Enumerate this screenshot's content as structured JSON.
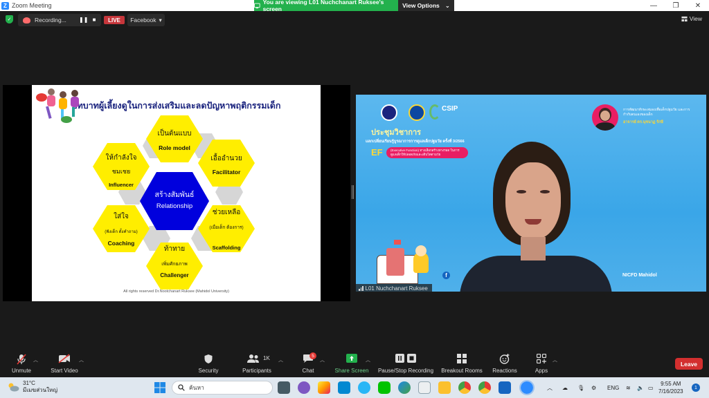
{
  "titlebar": {
    "app_title": "Zoom Meeting",
    "logo": "zoom-logo",
    "minimize": "—",
    "restore": "❐",
    "close": "✕"
  },
  "viewing_banner": {
    "text": "You are viewing L01 Nuchchanart Ruksee's screen",
    "options_label": "View Options"
  },
  "top_toolbar": {
    "recording_label": "Recording...",
    "live_label": "LIVE",
    "stream_target": "Facebook",
    "view_label": "View"
  },
  "slide": {
    "title": "บทบาทผู้เลี้ยงดูในการส่งเสริมและลดปัญหาพฤติกรรมเด็ก",
    "center_thai": "สร้างสัมพันธ์",
    "center_en": "Relationship",
    "hexes": [
      {
        "thai": "เป็นต้นแบบ",
        "en": "Role model",
        "sub": ""
      },
      {
        "thai": "เอื้ออำนวย",
        "en": "Facilitator",
        "sub": ""
      },
      {
        "thai": "ช่วยเหลือ",
        "en": "Scaffolding",
        "sub": "(เมื่อเด็ก ต้องการ)"
      },
      {
        "thai": "ท้าทาย",
        "en": "Challenger",
        "sub": "เพิ่มศักยภาพ"
      },
      {
        "thai": "ใส่ใจ",
        "en": "Coaching",
        "sub": "(ฟังเด็ก ตั้งคำถาม)"
      },
      {
        "thai": "ให้กำลังใจ",
        "en": "Influencer",
        "sub": "ชมเชย"
      }
    ],
    "copyright": "All rights reserved Dr.Nootchanart Ruksee (Mahidol University)",
    "colors": {
      "hex_yellow": "#ffee00",
      "center_blue": "#0000dd",
      "title_navy": "#1a237e",
      "hex_gray": "#d6d6d6"
    }
  },
  "video": {
    "participant": "L01 Nuchchanart Ruksee",
    "banner_title": "ประชุมวิชาการ",
    "banner_sub": "แลกเปลี่ยนเรียนรู้บูรณาการการดูแลเด็กปฐมวัย ครั้งที่ 3/2566",
    "banner_ef": "EF",
    "banner_pill": "(Executive Function) ทางเลือกสร้างทางรอด ในการดูแลเด็กให้ปลอดภัยและเติบโตตามวัย",
    "csip": "CSIP",
    "speaker_caption": "การพัฒนาทักษะสมองเพื่อเด็กปฐมวัย และการกำกับตนเองของเด็ก",
    "speaker_name": "อาจารย์ ดร.นุชนาฏ รักษี",
    "fb_label": "NICFD Mahidol"
  },
  "bottom_toolbar": {
    "items": [
      {
        "label": "Unmute",
        "icon": "mic-muted-icon"
      },
      {
        "label": "Start Video",
        "icon": "camera-off-icon"
      },
      {
        "label": "Security",
        "icon": "shield-icon"
      },
      {
        "label": "Participants",
        "icon": "participants-icon",
        "count": "1K"
      },
      {
        "label": "Chat",
        "icon": "chat-icon",
        "badge": "5"
      },
      {
        "label": "Share Screen",
        "icon": "share-screen-icon"
      },
      {
        "label": "Pause/Stop Recording",
        "icon": "pause-stop-icon"
      },
      {
        "label": "Breakout Rooms",
        "icon": "breakout-icon"
      },
      {
        "label": "Reactions",
        "icon": "reaction-icon"
      },
      {
        "label": "Apps",
        "icon": "apps-icon"
      }
    ],
    "leave_label": "Leave"
  },
  "taskbar": {
    "weather_temp": "31°C",
    "weather_desc": "มีเมฆส่วนใหญ่",
    "search_placeholder": "ค้นหา",
    "language": "ENG",
    "time": "9:55 AM",
    "date": "7/16/2023",
    "notification_count": "1"
  }
}
